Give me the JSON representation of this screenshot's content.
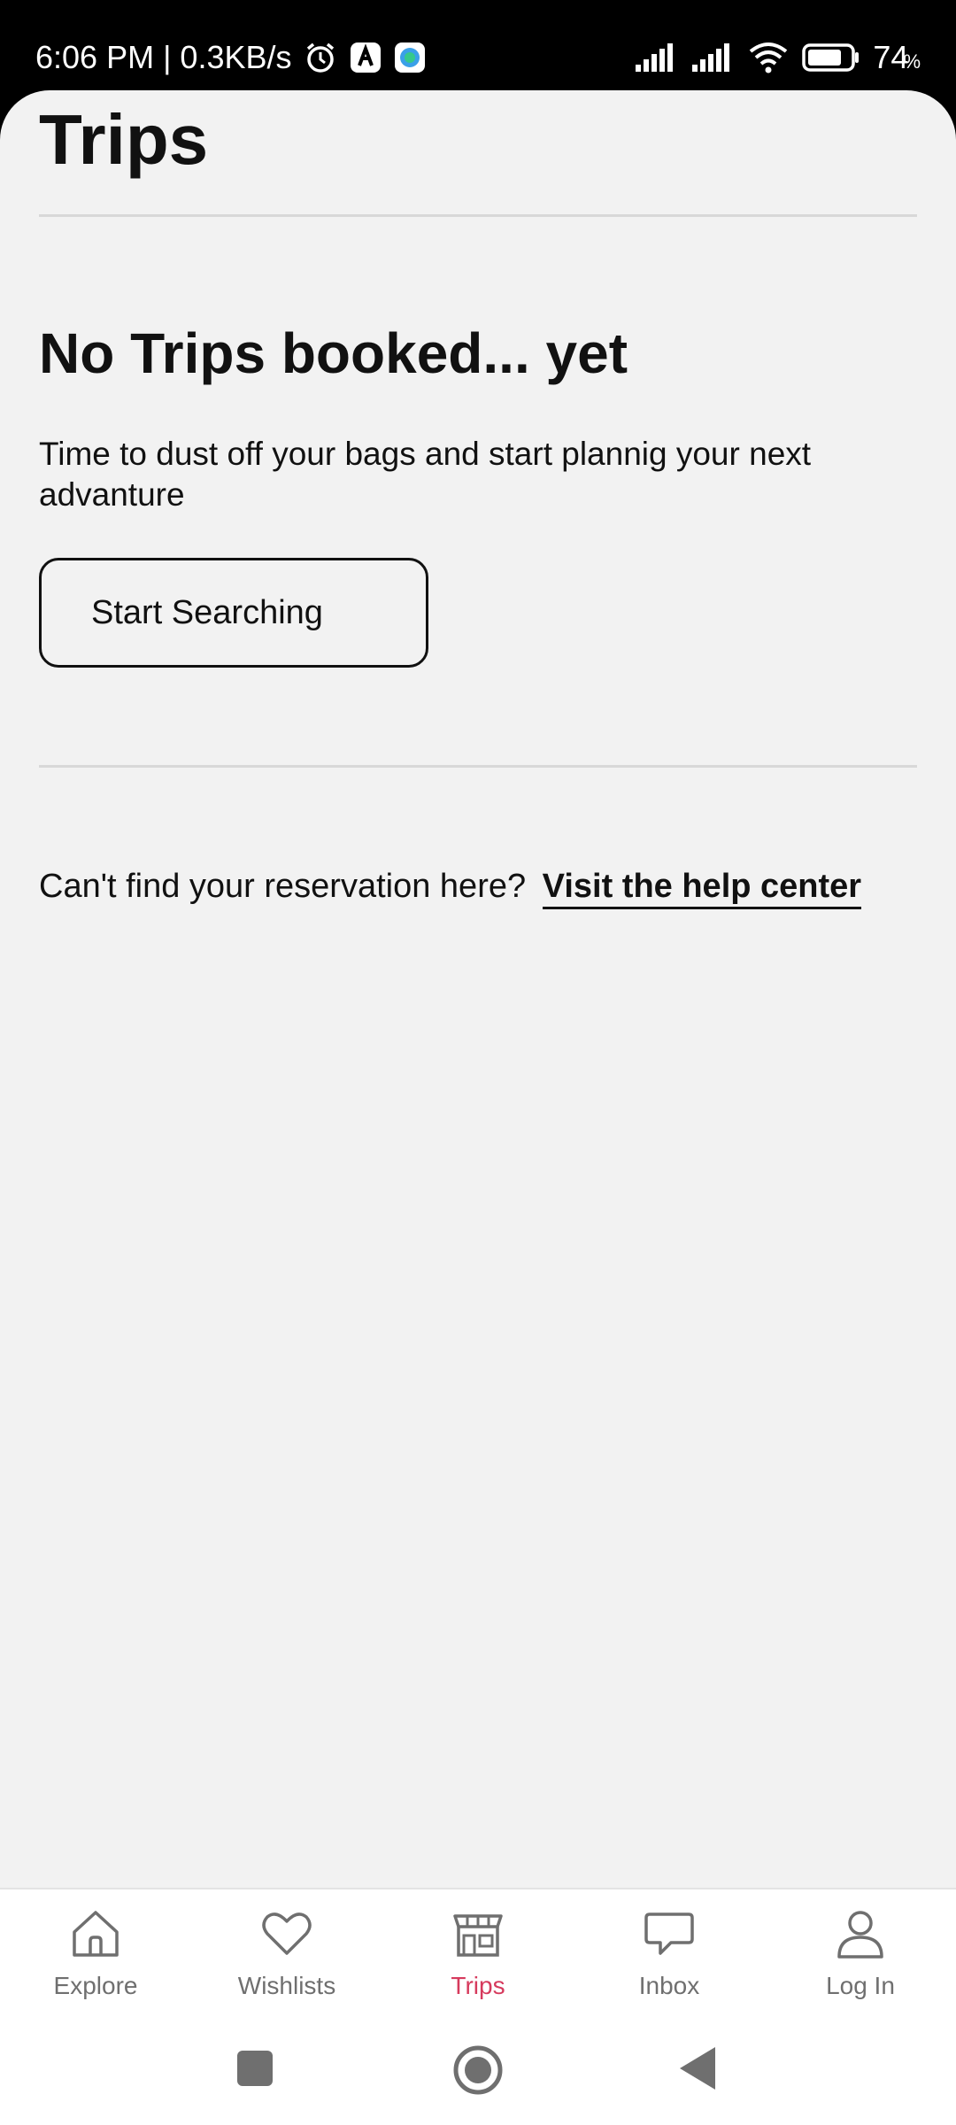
{
  "status_bar": {
    "time_speed": "6:06 PM | 0.3KB/s",
    "battery_percent": "74",
    "battery_suffix": "%",
    "icons": [
      "alarm-icon",
      "app-notification-icon",
      "app-notification-icon",
      "signal-icon",
      "signal-icon",
      "wifi-icon",
      "battery-icon"
    ]
  },
  "page": {
    "title": "Trips",
    "empty_heading": "No Trips booked... yet",
    "empty_body": "Time to dust off your bags and start plannig your next advanture",
    "start_button_label": "Start Searching",
    "help_prompt": "Can't find your reservation here?",
    "help_link": "Visit the help center"
  },
  "bottom_nav": {
    "active_color": "#d63a5d",
    "items": [
      {
        "label": "Explore",
        "icon": "home-icon"
      },
      {
        "label": "Wishlists",
        "icon": "heart-icon"
      },
      {
        "label": "Trips",
        "icon": "trips-icon",
        "active": true
      },
      {
        "label": "Inbox",
        "icon": "chat-icon"
      },
      {
        "label": "Log In",
        "icon": "person-icon"
      }
    ]
  },
  "system_nav": {
    "buttons": [
      "recents-button",
      "home-button",
      "back-button"
    ]
  }
}
